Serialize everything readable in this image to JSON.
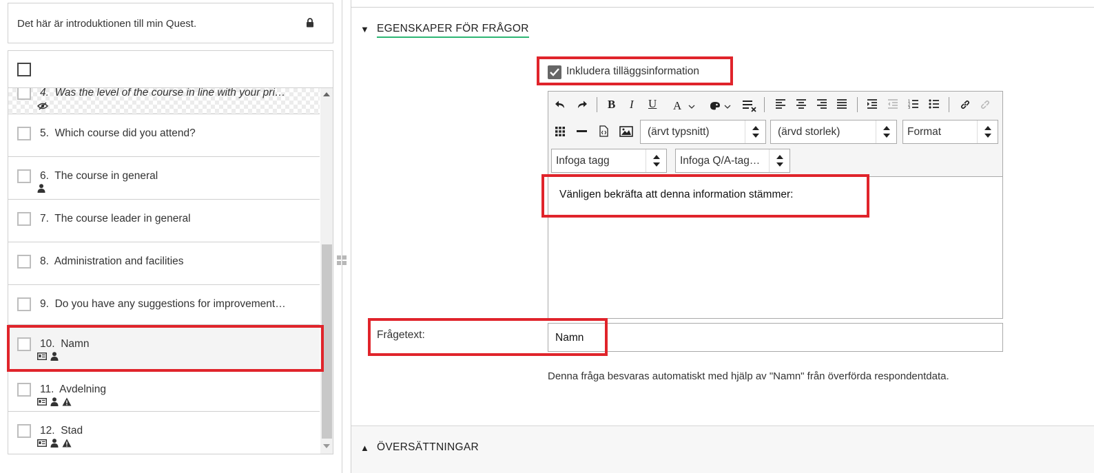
{
  "intro": {
    "text": "Det här är introduktionen till min Quest."
  },
  "questions": [
    {
      "num": "4.",
      "title": "Was the level of the course in line with your pri…"
    },
    {
      "num": "5.",
      "title": "Which course did you attend?"
    },
    {
      "num": "6.",
      "title": "The course in general"
    },
    {
      "num": "7.",
      "title": "The course leader in general"
    },
    {
      "num": "8.",
      "title": "Administration and facilities"
    },
    {
      "num": "9.",
      "title": "Do you have any suggestions for improvement…"
    },
    {
      "num": "10.",
      "title": "Namn"
    },
    {
      "num": "11.",
      "title": "Avdelning"
    },
    {
      "num": "12.",
      "title": "Stad"
    }
  ],
  "section1": {
    "toggle": "▼",
    "title": "EGENSKAPER FÖR FRÅGOR"
  },
  "include": {
    "label": "Inkludera tilläggsinformation",
    "checked": true
  },
  "toolbar": {
    "font_select": "(ärvt typsnitt)",
    "size_select": "(ärvd storlek)",
    "format_select": "Format",
    "insert_tag": "Infoga tagg",
    "insert_qa_tag": "Infoga Q/A-tag…"
  },
  "editor": {
    "content": "Vänligen bekräfta att denna information stämmer:"
  },
  "fragetext": {
    "label": "Frågetext:",
    "value": "Namn"
  },
  "auto_note": "Denna fråga besvaras automatiskt med hjälp av \"Namn\" från överförda respondentdata.",
  "section2": {
    "toggle": "▲",
    "title": "ÖVERSÄTTNINGAR"
  },
  "colors": {
    "highlight": "#e0242b",
    "accent_underline": "#2bb673"
  }
}
